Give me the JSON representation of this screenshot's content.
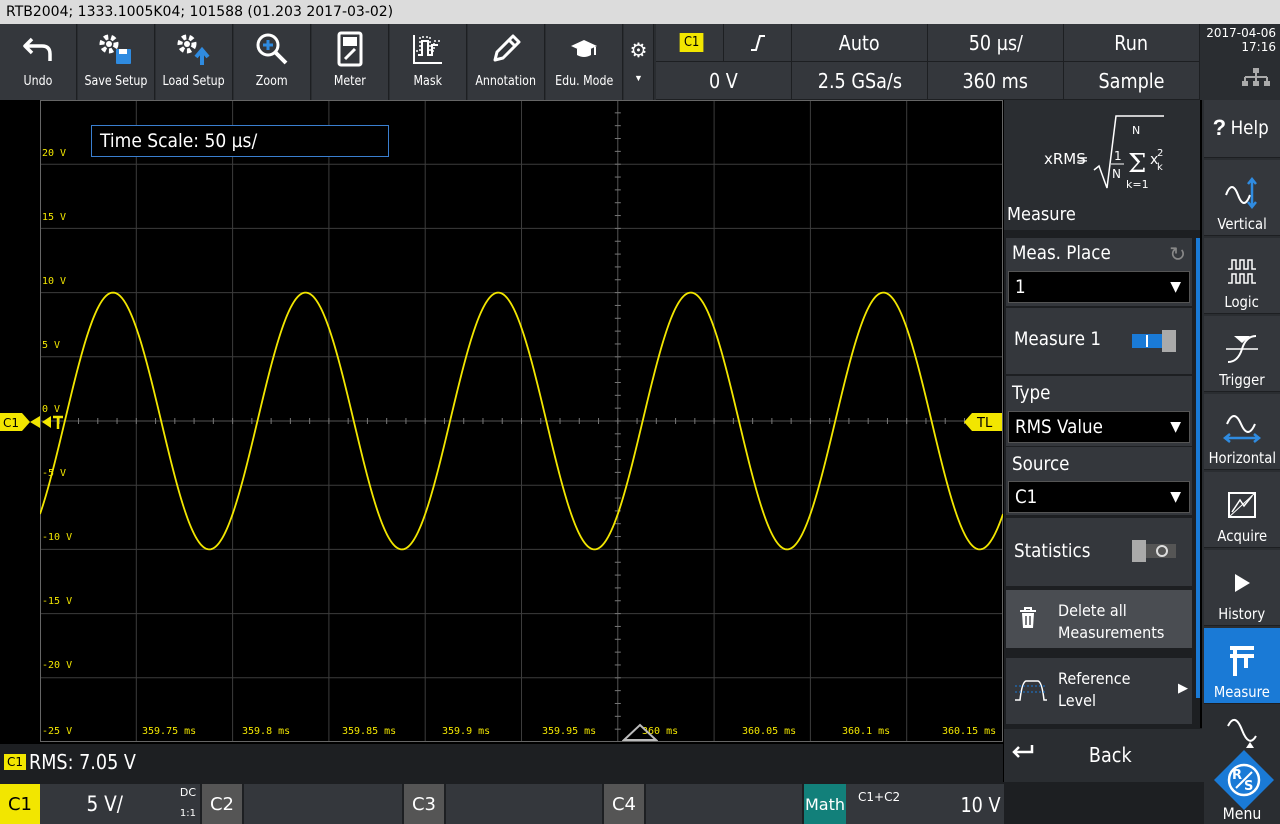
{
  "title_bar": "RTB2004; 1333.1005K04; 101588 (01.203 2017-03-02)",
  "toolbar": {
    "buttons": [
      {
        "label": "Undo",
        "icon": "undo-icon"
      },
      {
        "label": "Save Setup",
        "icon": "save-setup-icon"
      },
      {
        "label": "Load Setup",
        "icon": "load-setup-icon"
      },
      {
        "label": "Zoom",
        "icon": "zoom-icon"
      },
      {
        "label": "Meter",
        "icon": "meter-icon"
      },
      {
        "label": "Mask",
        "icon": "mask-icon"
      },
      {
        "label": "Annotation",
        "icon": "annotation-icon"
      },
      {
        "label": "Edu. Mode",
        "icon": "edu-mode-icon"
      }
    ]
  },
  "status": {
    "channel": "C1",
    "trigger_level": "0 V",
    "trigger_mode": "Auto",
    "sample_rate": "2.5 GSa/s",
    "time_scale": "50 µs/",
    "record_time": "360 ms",
    "run_state": "Run",
    "acq_mode": "Sample",
    "date": "2017-04-06",
    "time": "17:16"
  },
  "display": {
    "time_scale_box": "Time Scale: 50 µs/",
    "channel_marker": "C1",
    "trigger_level_marker": "TL",
    "voltage_labels": [
      "20 V",
      "15 V",
      "10 V",
      "5 V",
      "0 V",
      "-5 V",
      "-10 V",
      "-15 V",
      "-20 V",
      "-25 V"
    ],
    "time_labels": [
      "359.75 ms",
      "359.8 ms",
      "359.85 ms",
      "359.9 ms",
      "359.95 ms",
      "360 ms",
      "360.05 ms",
      "360.1 ms",
      "360.15 ms"
    ],
    "waveform_color": "#f2e600"
  },
  "measure_panel": {
    "formula_label": "xRMS",
    "title": "Measure",
    "meas_place_label": "Meas. Place",
    "meas_place_value": "1",
    "measure1_label": "Measure 1",
    "measure1_state": "on",
    "type_label": "Type",
    "type_value": "RMS Value",
    "source_label": "Source",
    "source_value": "C1",
    "statistics_label": "Statistics",
    "statistics_state": "off",
    "delete_all_line1": "Delete all",
    "delete_all_line2": "Measurements",
    "reference_line1": "Reference",
    "reference_line2": "Level",
    "back_label": "Back"
  },
  "side_menu": {
    "items": [
      {
        "label": "Help",
        "icon": "help-icon"
      },
      {
        "label": "Vertical",
        "icon": "vertical-icon"
      },
      {
        "label": "Logic",
        "icon": "logic-icon"
      },
      {
        "label": "Trigger",
        "icon": "trigger-icon"
      },
      {
        "label": "Horizontal",
        "icon": "horizontal-icon"
      },
      {
        "label": "Acquire",
        "icon": "acquire-icon"
      },
      {
        "label": "History",
        "icon": "history-icon"
      },
      {
        "label": "Measure",
        "icon": "measure-icon"
      },
      {
        "label": "Menu",
        "icon": "rs-logo-icon"
      }
    ]
  },
  "measurement_readout": {
    "badge": "C1",
    "text": "RMS: 7.05 V"
  },
  "channels": {
    "c1": {
      "label": "C1",
      "scale": "5 V/",
      "coupling": "DC",
      "probe": "1:1"
    },
    "c2": {
      "label": "C2"
    },
    "c3": {
      "label": "C3"
    },
    "c4": {
      "label": "C4"
    },
    "math": {
      "label": "Math",
      "expr": "C1+C2",
      "value": "10 V"
    }
  },
  "colors": {
    "c1": "#f2e600",
    "accent_blue": "#1a7ad6",
    "math_teal": "#12807a"
  }
}
